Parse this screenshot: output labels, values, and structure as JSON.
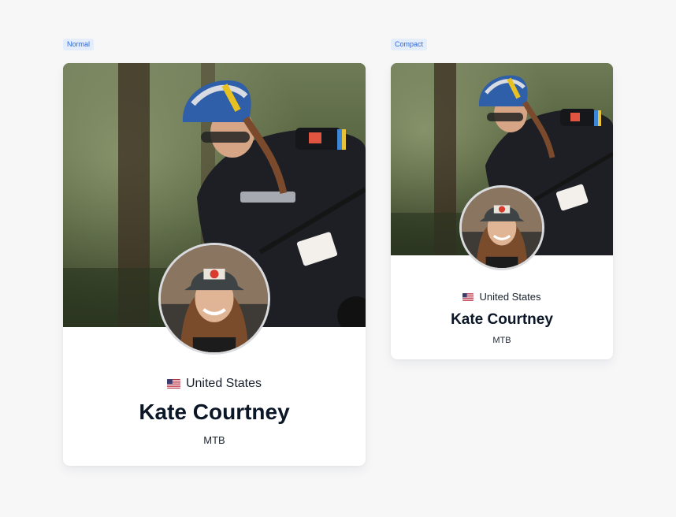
{
  "variants": [
    {
      "tag": "Normal",
      "athlete": {
        "country": "United States",
        "name": "Kate Courtney",
        "discipline": "MTB"
      }
    },
    {
      "tag": "Compact",
      "athlete": {
        "country": "United States",
        "name": "Kate Courtney",
        "discipline": "MTB"
      }
    }
  ],
  "icons": {
    "flag": "us-flag-icon"
  },
  "colors": {
    "page_background": "#f7f7f8",
    "card_background": "#ffffff",
    "tag_background": "#e3edfc",
    "tag_text": "#2f67d8",
    "name_text": "#0b1626"
  }
}
